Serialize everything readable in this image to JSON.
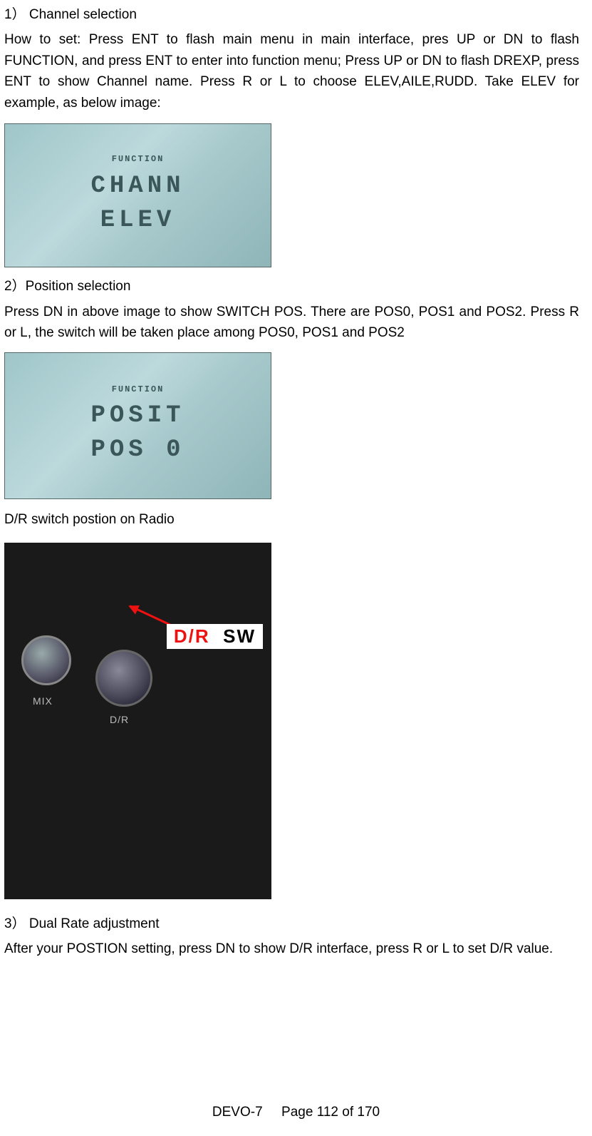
{
  "section1": {
    "heading": "1） Channel selection",
    "body": "How to set: Press ENT to flash main menu in main interface, pres UP or DN to flash FUNCTION, and press ENT to enter into function menu; Press UP or DN to flash DREXP, press ENT to show Channel name. Press R or L to choose ELEV,AILE,RUDD. Take ELEV for example, as below image:",
    "lcd_line1": "CHANN",
    "lcd_line2": "ELEV",
    "lcd_caption": "FUNCTION"
  },
  "section2": {
    "heading": "2）Position selection",
    "body": "Press DN in above image to show SWITCH POS. There are POS0, POS1 and POS2. Press R or L, the switch will be taken place among POS0, POS1 and POS2",
    "lcd_line1": "POSIT",
    "lcd_line2": "POS 0",
    "lcd_caption": "FUNCTION",
    "caption_after": "D/R switch postion on Radio"
  },
  "radio_image": {
    "annotation_red": "D/R",
    "annotation_black": "SW",
    "label_mix": "MIX",
    "label_dr": "D/R"
  },
  "section3": {
    "heading": "3） Dual Rate adjustment",
    "body": "After your POSTION setting, press DN to show D/R interface, press R or L to set D/R value."
  },
  "footer": {
    "model": "DEVO-7",
    "page_label": "Page 112 of 170"
  }
}
